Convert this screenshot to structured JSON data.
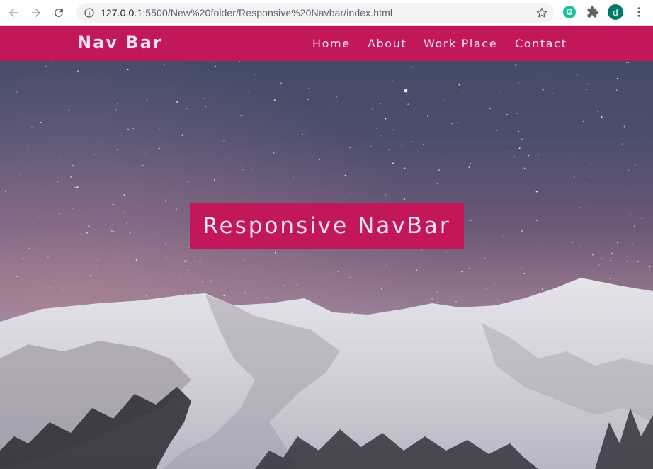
{
  "browser": {
    "url_host": "127.0.0.1",
    "url_rest": ":5500/New%20folder/Responsive%20Navbar/index.html",
    "extensions": [
      {
        "name": "grammarly",
        "glyph": "G",
        "color": "#15c39a"
      },
      {
        "name": "extensions",
        "icon": "puzzle-icon"
      }
    ],
    "profile_initial": "d",
    "profile_color": "#00796b"
  },
  "navbar": {
    "brand": "Nav Bar",
    "links": [
      "Home",
      "About",
      "Work Place",
      "Contact"
    ],
    "color": "#c2185b"
  },
  "hero": {
    "title": "Responsive NavBar"
  }
}
